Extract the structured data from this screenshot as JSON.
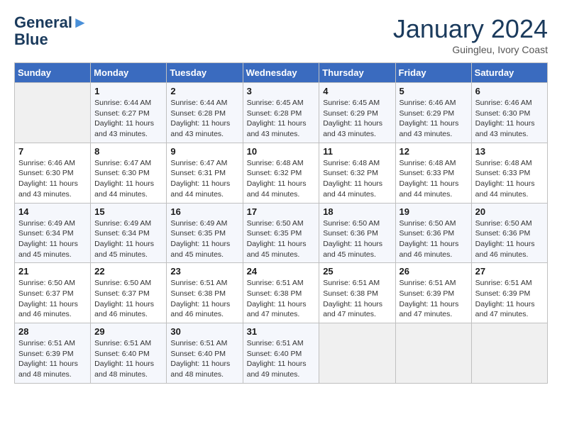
{
  "header": {
    "logo_line1": "General",
    "logo_line2": "Blue",
    "month": "January 2024",
    "location": "Guingleu, Ivory Coast"
  },
  "days_of_week": [
    "Sunday",
    "Monday",
    "Tuesday",
    "Wednesday",
    "Thursday",
    "Friday",
    "Saturday"
  ],
  "weeks": [
    [
      {
        "day": "",
        "sunrise": "",
        "sunset": "",
        "daylight": ""
      },
      {
        "day": "1",
        "sunrise": "6:44 AM",
        "sunset": "6:27 PM",
        "daylight": "11 hours and 43 minutes."
      },
      {
        "day": "2",
        "sunrise": "6:44 AM",
        "sunset": "6:28 PM",
        "daylight": "11 hours and 43 minutes."
      },
      {
        "day": "3",
        "sunrise": "6:45 AM",
        "sunset": "6:28 PM",
        "daylight": "11 hours and 43 minutes."
      },
      {
        "day": "4",
        "sunrise": "6:45 AM",
        "sunset": "6:29 PM",
        "daylight": "11 hours and 43 minutes."
      },
      {
        "day": "5",
        "sunrise": "6:46 AM",
        "sunset": "6:29 PM",
        "daylight": "11 hours and 43 minutes."
      },
      {
        "day": "6",
        "sunrise": "6:46 AM",
        "sunset": "6:30 PM",
        "daylight": "11 hours and 43 minutes."
      }
    ],
    [
      {
        "day": "7",
        "sunrise": "6:46 AM",
        "sunset": "6:30 PM",
        "daylight": "11 hours and 43 minutes."
      },
      {
        "day": "8",
        "sunrise": "6:47 AM",
        "sunset": "6:30 PM",
        "daylight": "11 hours and 44 minutes."
      },
      {
        "day": "9",
        "sunrise": "6:47 AM",
        "sunset": "6:31 PM",
        "daylight": "11 hours and 44 minutes."
      },
      {
        "day": "10",
        "sunrise": "6:48 AM",
        "sunset": "6:32 PM",
        "daylight": "11 hours and 44 minutes."
      },
      {
        "day": "11",
        "sunrise": "6:48 AM",
        "sunset": "6:32 PM",
        "daylight": "11 hours and 44 minutes."
      },
      {
        "day": "12",
        "sunrise": "6:48 AM",
        "sunset": "6:33 PM",
        "daylight": "11 hours and 44 minutes."
      },
      {
        "day": "13",
        "sunrise": "6:48 AM",
        "sunset": "6:33 PM",
        "daylight": "11 hours and 44 minutes."
      }
    ],
    [
      {
        "day": "14",
        "sunrise": "6:49 AM",
        "sunset": "6:34 PM",
        "daylight": "11 hours and 45 minutes."
      },
      {
        "day": "15",
        "sunrise": "6:49 AM",
        "sunset": "6:34 PM",
        "daylight": "11 hours and 45 minutes."
      },
      {
        "day": "16",
        "sunrise": "6:49 AM",
        "sunset": "6:35 PM",
        "daylight": "11 hours and 45 minutes."
      },
      {
        "day": "17",
        "sunrise": "6:50 AM",
        "sunset": "6:35 PM",
        "daylight": "11 hours and 45 minutes."
      },
      {
        "day": "18",
        "sunrise": "6:50 AM",
        "sunset": "6:36 PM",
        "daylight": "11 hours and 45 minutes."
      },
      {
        "day": "19",
        "sunrise": "6:50 AM",
        "sunset": "6:36 PM",
        "daylight": "11 hours and 46 minutes."
      },
      {
        "day": "20",
        "sunrise": "6:50 AM",
        "sunset": "6:36 PM",
        "daylight": "11 hours and 46 minutes."
      }
    ],
    [
      {
        "day": "21",
        "sunrise": "6:50 AM",
        "sunset": "6:37 PM",
        "daylight": "11 hours and 46 minutes."
      },
      {
        "day": "22",
        "sunrise": "6:50 AM",
        "sunset": "6:37 PM",
        "daylight": "11 hours and 46 minutes."
      },
      {
        "day": "23",
        "sunrise": "6:51 AM",
        "sunset": "6:38 PM",
        "daylight": "11 hours and 46 minutes."
      },
      {
        "day": "24",
        "sunrise": "6:51 AM",
        "sunset": "6:38 PM",
        "daylight": "11 hours and 47 minutes."
      },
      {
        "day": "25",
        "sunrise": "6:51 AM",
        "sunset": "6:38 PM",
        "daylight": "11 hours and 47 minutes."
      },
      {
        "day": "26",
        "sunrise": "6:51 AM",
        "sunset": "6:39 PM",
        "daylight": "11 hours and 47 minutes."
      },
      {
        "day": "27",
        "sunrise": "6:51 AM",
        "sunset": "6:39 PM",
        "daylight": "11 hours and 47 minutes."
      }
    ],
    [
      {
        "day": "28",
        "sunrise": "6:51 AM",
        "sunset": "6:39 PM",
        "daylight": "11 hours and 48 minutes."
      },
      {
        "day": "29",
        "sunrise": "6:51 AM",
        "sunset": "6:40 PM",
        "daylight": "11 hours and 48 minutes."
      },
      {
        "day": "30",
        "sunrise": "6:51 AM",
        "sunset": "6:40 PM",
        "daylight": "11 hours and 48 minutes."
      },
      {
        "day": "31",
        "sunrise": "6:51 AM",
        "sunset": "6:40 PM",
        "daylight": "11 hours and 49 minutes."
      },
      {
        "day": "",
        "sunrise": "",
        "sunset": "",
        "daylight": ""
      },
      {
        "day": "",
        "sunrise": "",
        "sunset": "",
        "daylight": ""
      },
      {
        "day": "",
        "sunrise": "",
        "sunset": "",
        "daylight": ""
      }
    ]
  ]
}
